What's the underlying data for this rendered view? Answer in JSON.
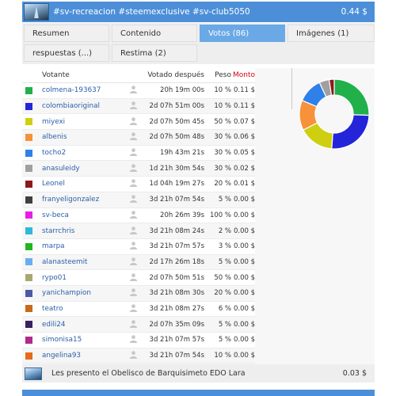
{
  "post": {
    "title": "#sv-recreacion #steemexclusive #sv-club5050",
    "amount": "0.44 $"
  },
  "tabs": [
    {
      "label": "Resumen",
      "active": false
    },
    {
      "label": "Contenido",
      "active": false
    },
    {
      "label": "Votos (86)",
      "active": true
    },
    {
      "label": "Imágenes (1)",
      "active": false
    },
    {
      "label": "respuestas (...)",
      "active": false
    },
    {
      "label": "Restima (2)",
      "active": false
    }
  ],
  "table": {
    "headers": {
      "voter": "Votante",
      "time": "Votado después",
      "weight": "Peso",
      "amount": "Monto"
    },
    "rows": [
      {
        "name": "colmena-193637",
        "time": "20h 19m 00s",
        "weight": "10 %",
        "amount": "0.11 $",
        "color": "#22b04b"
      },
      {
        "name": "colombiaoriginal",
        "time": "2d 07h 51m 00s",
        "weight": "10 %",
        "amount": "0.11 $",
        "color": "#2424d8"
      },
      {
        "name": "miyexi",
        "time": "2d 07h 50m 45s",
        "weight": "50 %",
        "amount": "0.07 $",
        "color": "#cfcf12"
      },
      {
        "name": "albenis",
        "time": "2d 07h 50m 48s",
        "weight": "30 %",
        "amount": "0.06 $",
        "color": "#f7923a"
      },
      {
        "name": "tocho2",
        "time": "19h 43m 21s",
        "weight": "30 %",
        "amount": "0.05 $",
        "color": "#2f80e8"
      },
      {
        "name": "anasuleidy",
        "time": "1d 21h 30m 54s",
        "weight": "30 %",
        "amount": "0.02 $",
        "color": "#a0a0a0"
      },
      {
        "name": "Leonel",
        "time": "1d 04h 19m 27s",
        "weight": "20 %",
        "amount": "0.01 $",
        "color": "#8b1a1a"
      },
      {
        "name": "franyeligonzalez",
        "time": "3d 21h 07m 54s",
        "weight": "5 %",
        "amount": "0.00 $",
        "color": "#404040"
      },
      {
        "name": "sv-beca",
        "time": "20h 26m 39s",
        "weight": "100 %",
        "amount": "0.00 $",
        "color": "#e81ee8"
      },
      {
        "name": "starrchris",
        "time": "3d 21h 08m 24s",
        "weight": "2 %",
        "amount": "0.00 $",
        "color": "#2eb8d8"
      },
      {
        "name": "marpa",
        "time": "3d 21h 07m 57s",
        "weight": "3 %",
        "amount": "0.00 $",
        "color": "#1eb81e"
      },
      {
        "name": "alanasteemit",
        "time": "2d 17h 26m 18s",
        "weight": "5 %",
        "amount": "0.00 $",
        "color": "#6aaef0"
      },
      {
        "name": "rypo01",
        "time": "2d 07h 50m 51s",
        "weight": "50 %",
        "amount": "0.00 $",
        "color": "#a8a870"
      },
      {
        "name": "yanichampion",
        "time": "3d 21h 08m 30s",
        "weight": "20 %",
        "amount": "0.00 $",
        "color": "#4a5aa8"
      },
      {
        "name": "teatro",
        "time": "3d 21h 08m 27s",
        "weight": "6 %",
        "amount": "0.00 $",
        "color": "#c86a1a"
      },
      {
        "name": "edili24",
        "time": "2d 07h 35m 09s",
        "weight": "5 %",
        "amount": "0.00 $",
        "color": "#3a2060"
      },
      {
        "name": "simonisa15",
        "time": "3d 21h 07m 57s",
        "weight": "5 %",
        "amount": "0.00 $",
        "color": "#b02a8a"
      },
      {
        "name": "angelina93",
        "time": "3d 21h 07m 54s",
        "weight": "10 %",
        "amount": "0.00 $",
        "color": "#e86a1a"
      }
    ]
  },
  "chart_data": {
    "type": "pie",
    "values": [
      0.11,
      0.11,
      0.07,
      0.06,
      0.05,
      0.02,
      0.01
    ],
    "colors": [
      "#22b04b",
      "#2424d8",
      "#cfcf12",
      "#f7923a",
      "#2f80e8",
      "#a0a0a0",
      "#8b1a1a"
    ]
  },
  "next_post": {
    "title": "Les presento el Obelisco de Barquisimeto EDO Lara",
    "amount": "0.03 $"
  },
  "icons": {
    "post_thumbnail": "post-thumbnail-image",
    "avatar": "user-avatar-icon"
  }
}
